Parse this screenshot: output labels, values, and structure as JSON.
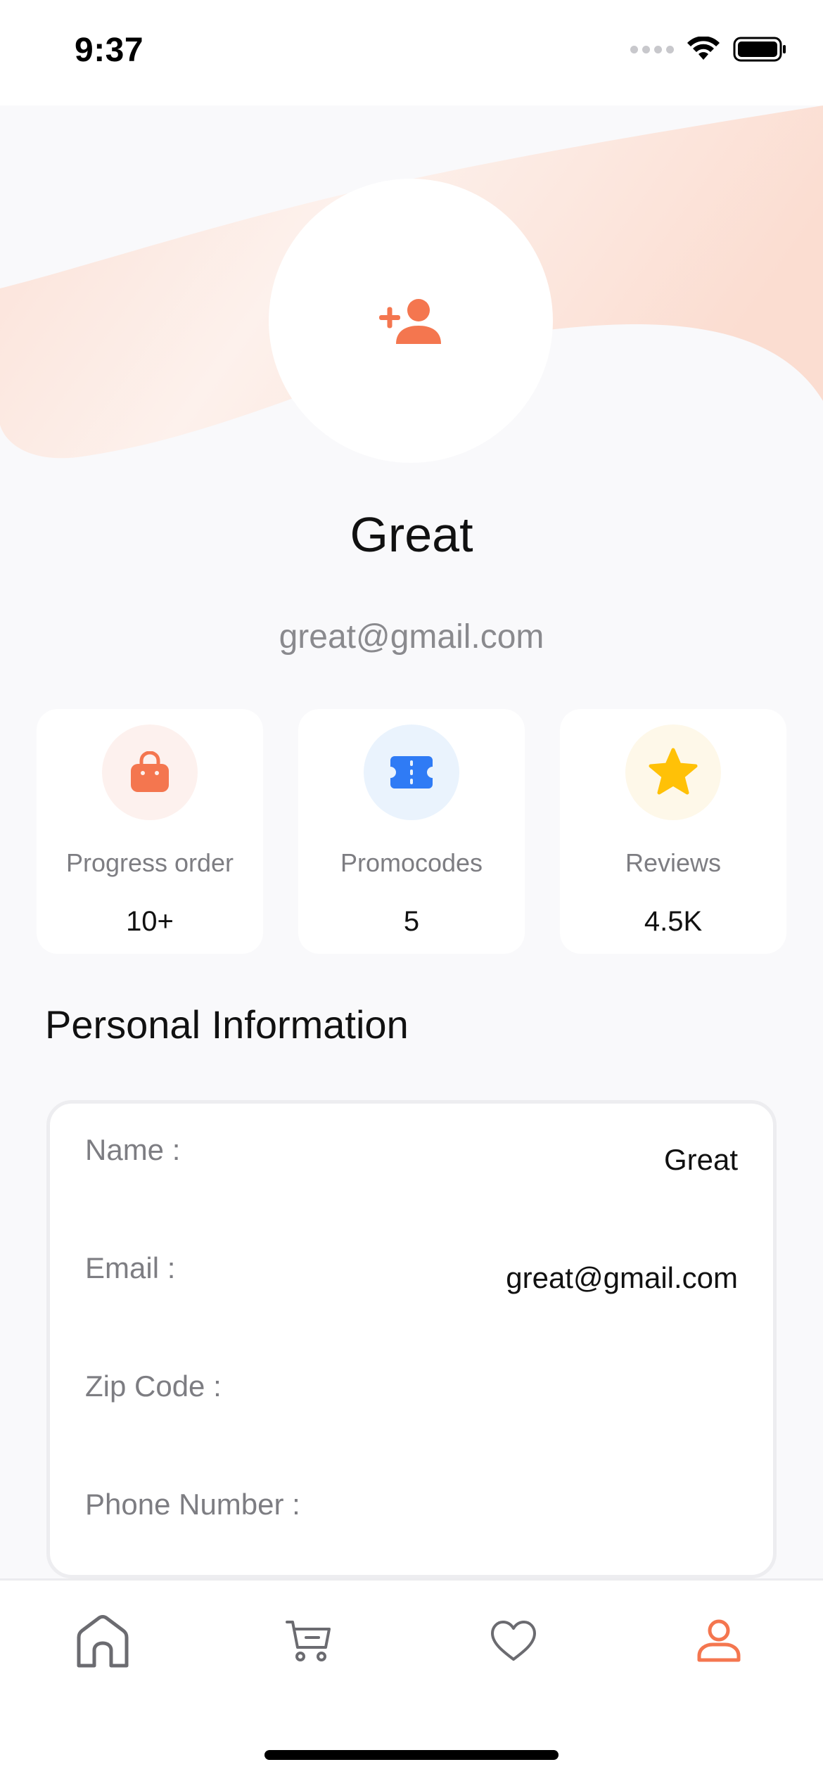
{
  "status_bar": {
    "time": "9:37"
  },
  "profile": {
    "name": "Great",
    "email": "great@gmail.com",
    "avatar_icon": "add-person-icon"
  },
  "stats": [
    {
      "label": "Progress order",
      "value": "10+",
      "icon": "shopping-bag-icon",
      "color": "#F4764F",
      "bg": "#FDF1EE"
    },
    {
      "label": "Promocodes",
      "value": "5",
      "icon": "ticket-icon",
      "color": "#2F7BF5",
      "bg": "#EAF3FD"
    },
    {
      "label": "Reviews",
      "value": "4.5K",
      "icon": "star-icon",
      "color": "#FFC107",
      "bg": "#FEF8E9"
    }
  ],
  "personal_info": {
    "title": "Personal Information",
    "rows": [
      {
        "label": "Name :",
        "value": "Great"
      },
      {
        "label": "Email :",
        "value": "great@gmail.com"
      },
      {
        "label": "Zip Code :",
        "value": ""
      },
      {
        "label": "Phone Number :",
        "value": ""
      }
    ]
  },
  "nav": {
    "items": [
      {
        "name": "home",
        "icon": "home-icon",
        "active": false
      },
      {
        "name": "cart",
        "icon": "cart-icon",
        "active": false
      },
      {
        "name": "favorites",
        "icon": "heart-icon",
        "active": false
      },
      {
        "name": "profile",
        "icon": "person-icon",
        "active": true
      }
    ]
  },
  "colors": {
    "accent": "#F4764F",
    "inactive_icon": "#6B6B70",
    "background": "#F9F9FB"
  }
}
